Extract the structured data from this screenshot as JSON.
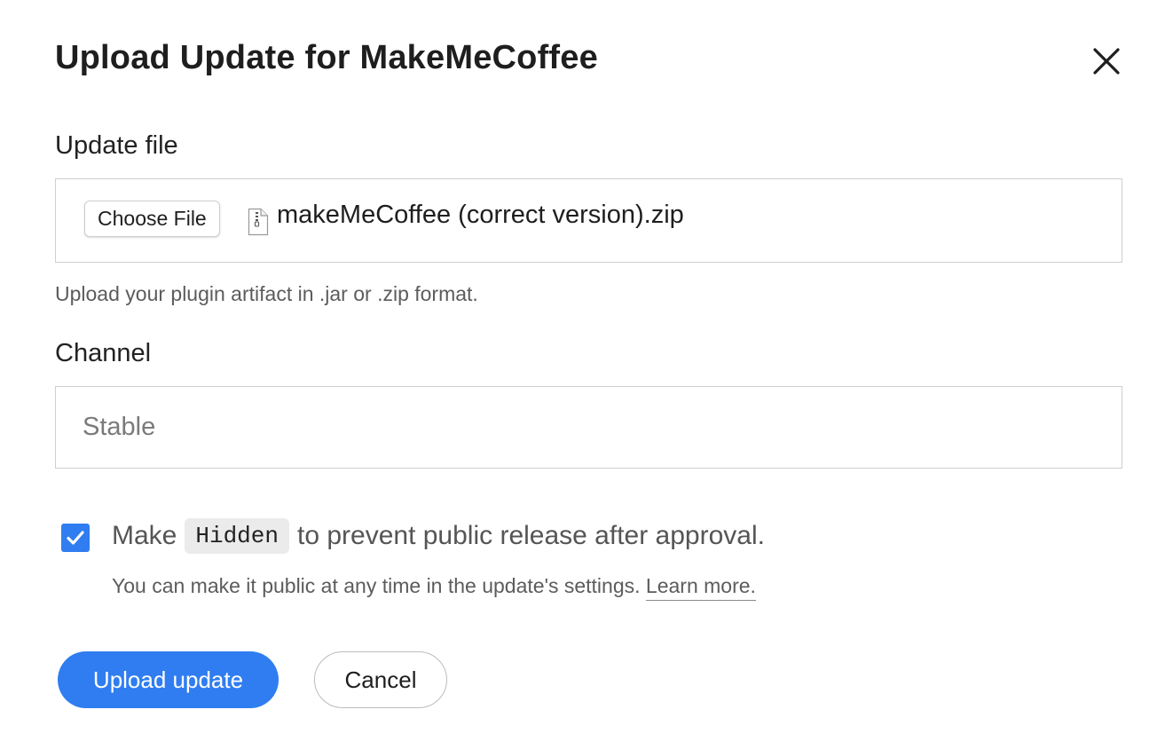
{
  "dialog": {
    "title": "Upload Update for MakeMeCoffee",
    "close_icon": "close-icon"
  },
  "update_file": {
    "label": "Update file",
    "choose_button_label": "Choose File",
    "file_icon": "zip-file-icon",
    "file_name": "makeMeCoffee (correct version).zip",
    "hint": "Upload your plugin artifact in .jar or .zip format."
  },
  "channel": {
    "label": "Channel",
    "value": "",
    "placeholder": "Stable"
  },
  "hidden_option": {
    "checked": true,
    "text_before": "Make",
    "code": "Hidden",
    "text_after": "to prevent public release after approval.",
    "note": "You can make it public at any time in the update's settings.",
    "learn_more_label": "Learn more."
  },
  "actions": {
    "primary_label": "Upload update",
    "secondary_label": "Cancel"
  },
  "colors": {
    "accent": "#2f7df0",
    "border": "#cfcfcf",
    "muted_text": "#5c5c5c",
    "code_background": "#ebebeb"
  }
}
